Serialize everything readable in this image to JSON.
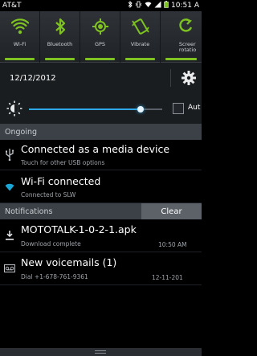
{
  "status_bar": {
    "carrier": "AT&T",
    "time": "10:51 A"
  },
  "toggles": [
    {
      "label": "Wi-Fi",
      "icon": "wifi-icon",
      "active": true
    },
    {
      "label": "Bluetooth",
      "icon": "bluetooth-icon",
      "active": true
    },
    {
      "label": "GPS",
      "icon": "gps-icon",
      "active": true
    },
    {
      "label": "Vibrate",
      "icon": "vibrate-icon",
      "active": true
    },
    {
      "label": "Screen rotation",
      "label_line1": "Screer",
      "label_line2": "rotatio",
      "icon": "rotation-icon",
      "active": true
    }
  ],
  "date_row": {
    "date": "12/12/2012",
    "settings_icon": "gear-icon"
  },
  "brightness": {
    "level": 0.84,
    "auto_label": "Aut",
    "auto_checked": false
  },
  "ongoing": {
    "header": "Ongoing",
    "items": [
      {
        "title": "Connected as a media device",
        "subtitle": "Touch for other USB options",
        "icon": "usb-icon"
      },
      {
        "title": "Wi-Fi connected",
        "subtitle": "Connected to SLW",
        "icon": "wifi-small-icon"
      }
    ]
  },
  "notifications": {
    "header": "Notifications",
    "clear_label": "Clear",
    "items": [
      {
        "title": "MOTOTALK-1-0-2-1.apk",
        "subtitle": "Download complete",
        "time": "10:50 AM",
        "icon": "download-icon"
      },
      {
        "title": "New voicemails (1)",
        "subtitle": "Dial +1-678-761-9361",
        "time": "12-11-201",
        "icon": "voicemail-icon"
      }
    ]
  },
  "colors": {
    "accent_green": "#7ec321",
    "slider_blue": "#2fa6e6",
    "section_header": "#3b4147"
  }
}
